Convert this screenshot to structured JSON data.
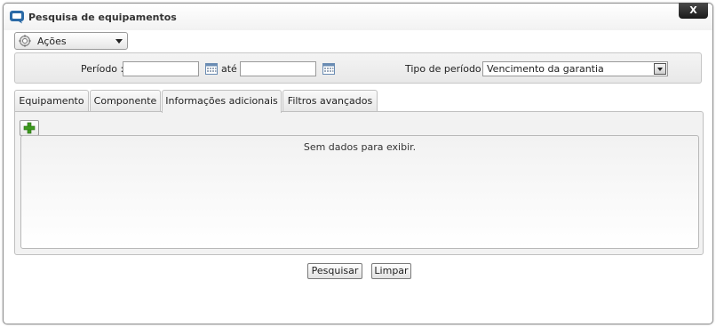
{
  "dialog": {
    "title": "Pesquisa de equipamentos",
    "close_label": "X"
  },
  "actions": {
    "label": "Ações"
  },
  "filters": {
    "period_label": "Período :",
    "period_start_value": "",
    "period_to_label": "até",
    "period_end_value": "",
    "period_type_label": "Tipo de período :",
    "period_type_value": "Vencimento da garantia"
  },
  "tabs": [
    {
      "label": "Equipamento",
      "active": false
    },
    {
      "label": "Componente",
      "active": false
    },
    {
      "label": "Informações adicionais",
      "active": true
    },
    {
      "label": "Filtros avançados",
      "active": false
    }
  ],
  "grid": {
    "empty_message": "Sem dados para exibir."
  },
  "buttons": {
    "search_label": "Pesquisar",
    "clear_label": "Limpar"
  },
  "colors": {
    "accent": "#2b6aa6",
    "add_icon": "#3c9a1e"
  },
  "icons": {
    "title": "window-icon",
    "actions": "gear-icon",
    "calendar": "calendar-icon",
    "add": "plus-icon"
  }
}
